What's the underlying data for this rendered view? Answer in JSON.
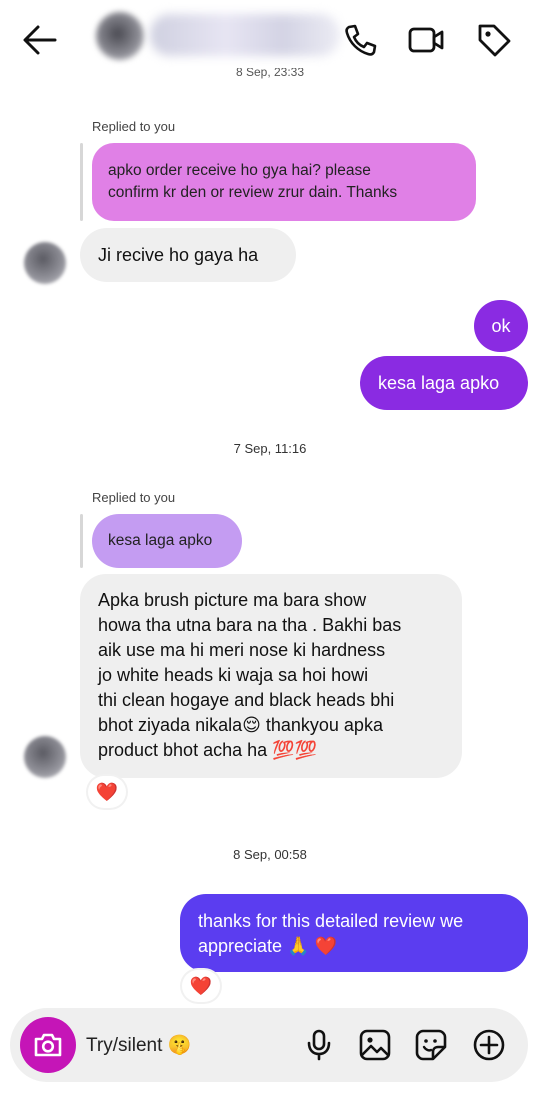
{
  "header": {
    "contact_name": "",
    "icons": [
      "back-arrow-icon",
      "phone-icon",
      "video-icon",
      "tag-icon"
    ]
  },
  "timestamps": {
    "first_cut": "8 Sep, 23:33",
    "second": "7 Sep, 11:16",
    "third": "8 Sep, 00:58"
  },
  "thread": {
    "replied_label": "Replied to you",
    "reply1_quote_line1": "apko order receive ho gya hai? please",
    "reply1_quote_line2": "confirm kr den or review zrur dain. Thanks",
    "msg_in1": "Ji recive ho gaya ha",
    "msg_out1": "ok",
    "msg_out2": "kesa laga apko",
    "reply2_quote": "kesa laga apko",
    "msg_in2_lines": [
      "Apka brush picture ma bara show",
      "howa tha utna bara na tha . Bakhi bas",
      "aik use ma hi meri nose ki hardness",
      "jo white heads ki waja sa hoi howi",
      "thi clean hogaye and black heads bhi",
      "bhot ziyada nikala😌 thankyou apka",
      "product bhot acha ha 💯💯"
    ],
    "msg_out3_line1": "thanks for this detailed review we",
    "msg_out3_line2": "appreciate 🙏 ❤️",
    "reaction": "❤️"
  },
  "composer": {
    "value": "Try/silent 🤫",
    "icons": [
      "camera-icon",
      "microphone-icon",
      "gallery-icon",
      "sticker-icon",
      "plus-circle-icon"
    ]
  },
  "colors": {
    "reply_quote_bg": "#e080e6",
    "reply_quote2_bg": "#c49cf2",
    "out_purple": "#8a2be2",
    "out_blue": "#5b3df0",
    "camera_bg": "#c515b7",
    "incoming_bg": "#efefef"
  }
}
